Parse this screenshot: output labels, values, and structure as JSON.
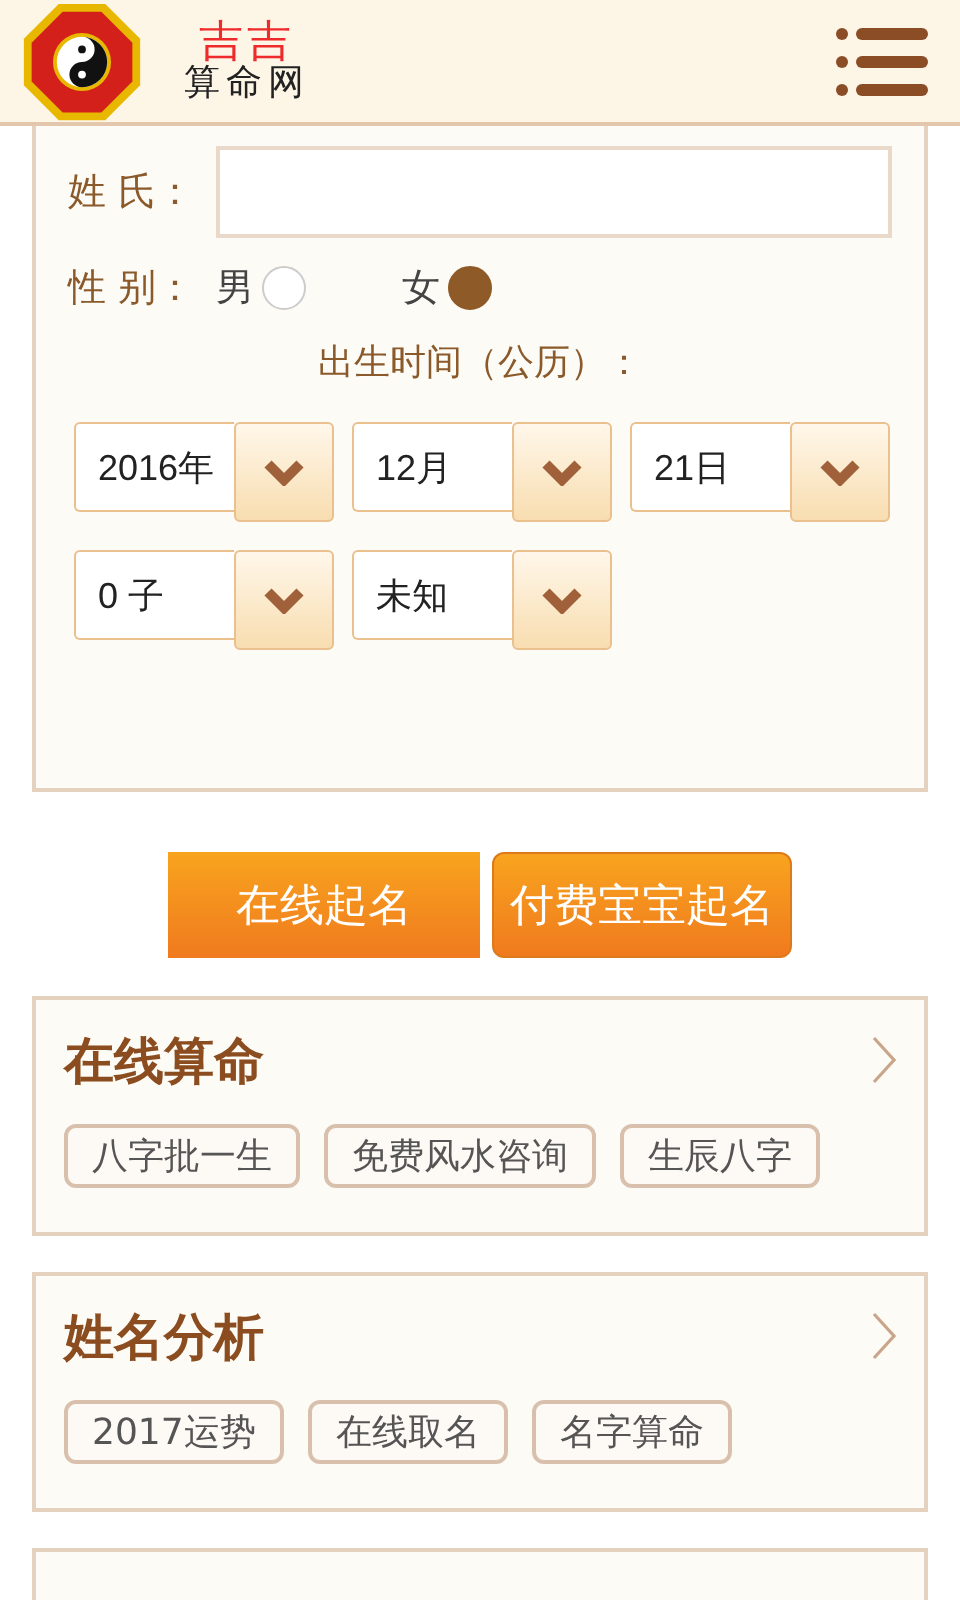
{
  "header": {
    "logo_top": "吉吉",
    "logo_bottom": "算命网"
  },
  "form": {
    "name_label": "姓 氏：",
    "gender_label": "性 别：",
    "genders": [
      {
        "label": "男",
        "selected": false
      },
      {
        "label": "女",
        "selected": true
      }
    ],
    "birth_label": "出生时间（公历）：",
    "selects": [
      {
        "value": "2016年"
      },
      {
        "value": "12月"
      },
      {
        "value": "21日"
      },
      {
        "value": "0 子"
      },
      {
        "value": "未知"
      }
    ]
  },
  "buttons": [
    {
      "label": "在线起名",
      "kind": "flat"
    },
    {
      "label": "付费宝宝起名",
      "kind": "rounded"
    }
  ],
  "sections": [
    {
      "title": "在线算命",
      "tags": [
        "八字批一生",
        "免费风水咨询",
        "生辰八字"
      ]
    },
    {
      "title": "姓名分析",
      "tags": [
        "2017运势",
        "在线取名",
        "名字算命"
      ]
    }
  ]
}
